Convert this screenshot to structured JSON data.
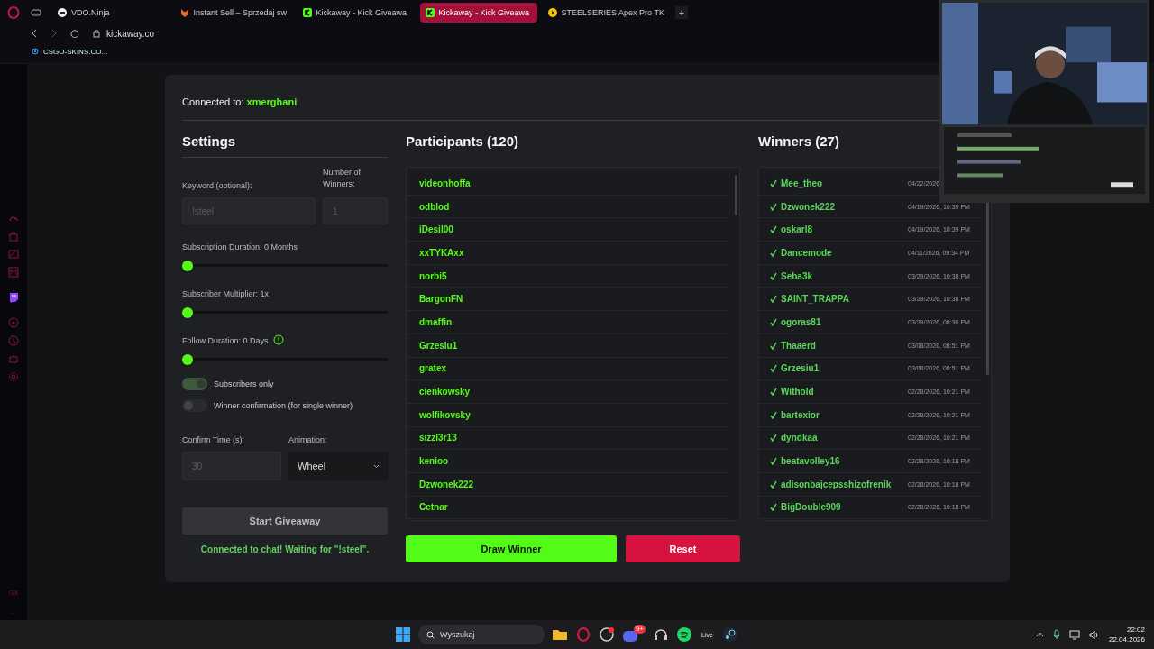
{
  "browser": {
    "tabs": [
      {
        "label": "VDO.Ninja",
        "selected": false,
        "kind": "ninja"
      },
      {
        "label": "Instant Sell – Sprzedaj sw",
        "selected": false,
        "kind": "fox"
      },
      {
        "label": "Kickaway - Kick Giveawa",
        "selected": false,
        "kind": "kick"
      },
      {
        "label": "Kickaway - Kick Giveawa",
        "selected": true,
        "kind": "kick"
      },
      {
        "label": "STEELSERIES Apex Pro TK",
        "selected": false,
        "kind": "play"
      }
    ],
    "new_tab": "+",
    "address": "kickaway.co",
    "bookmark": "CSGO-SKINS.CO..."
  },
  "sidebar": {
    "bottom_items": [
      "GX",
      "..."
    ]
  },
  "connection": {
    "label": "Connected to:",
    "channel": "xmerghani"
  },
  "settings": {
    "title": "Settings",
    "keyword": {
      "label": "Keyword (optional):",
      "placeholder": "!steel"
    },
    "winners_count": {
      "label": "Number of Winners:",
      "placeholder": "1"
    },
    "sliders": [
      {
        "label": "Subscription Duration: 0 Months",
        "level": 0,
        "info": false
      },
      {
        "label": "Subscriber Multiplier: 1x",
        "level": 0,
        "info": false
      },
      {
        "label": "Follow Duration:  0  Days",
        "level": 0,
        "info": true
      }
    ],
    "toggles": [
      {
        "label": "Subscribers only",
        "on": true
      },
      {
        "label": "Winner confirmation (for single winner)",
        "on": false
      }
    ],
    "confirm_time": {
      "label": "Confirm Time (s):",
      "placeholder": "30"
    },
    "animation": {
      "label": "Animation:",
      "value": "Wheel"
    },
    "start_button": "Start Giveaway",
    "status": "Connected to chat! Waiting for \"!steel\"."
  },
  "participants": {
    "title": "Participants (120)",
    "names": [
      "videonhoffa",
      "odblod",
      "iDesil00",
      "xxTYKAxx",
      "norbi5",
      "BargonFN",
      "dmaffin",
      "Grzesiu1",
      "gratex",
      "cienkowsky",
      "wolfikovsky",
      "sizzl3r13",
      "kenioo",
      "Dzwonek222",
      "Cetnar"
    ],
    "draw_button": "Draw Winner",
    "reset_button": "Reset"
  },
  "winners": {
    "title": "Winners (27)",
    "rows": [
      {
        "name": "Mee_theo",
        "date": "04/22/2026,"
      },
      {
        "name": "Dzwonek222",
        "date": "04/19/2026, 10:39 PM"
      },
      {
        "name": "oskarl8",
        "date": "04/19/2026, 10:39 PM"
      },
      {
        "name": "Dancemode",
        "date": "04/11/2026, 09:34 PM"
      },
      {
        "name": "Seba3k",
        "date": "03/29/2026, 10:38 PM"
      },
      {
        "name": "SAINT_TRAPPA",
        "date": "03/29/2026, 10:38 PM"
      },
      {
        "name": "ogoras81",
        "date": "03/29/2026, 08:36 PM"
      },
      {
        "name": "Thaaerd",
        "date": "03/08/2026, 08:51 PM"
      },
      {
        "name": "Grzesiu1",
        "date": "03/08/2026, 08:51 PM"
      },
      {
        "name": "Withold",
        "date": "02/28/2026, 10:21 PM"
      },
      {
        "name": "bartexior",
        "date": "02/28/2026, 10:21 PM"
      },
      {
        "name": "dyndkaa",
        "date": "02/28/2026, 10:21 PM"
      },
      {
        "name": "beatavolley16",
        "date": "02/28/2026, 10:18 PM"
      },
      {
        "name": "adisonbajcepsshizofrenik",
        "date": "02/28/2026, 10:18 PM"
      },
      {
        "name": "BigDouble909",
        "date": "02/28/2026, 10:18 PM"
      }
    ]
  },
  "taskbar": {
    "search_placeholder": "Wyszukaj",
    "discord_badge": "9+",
    "live_label": "Live",
    "time": "22:02",
    "date": "22.04.2026"
  }
}
